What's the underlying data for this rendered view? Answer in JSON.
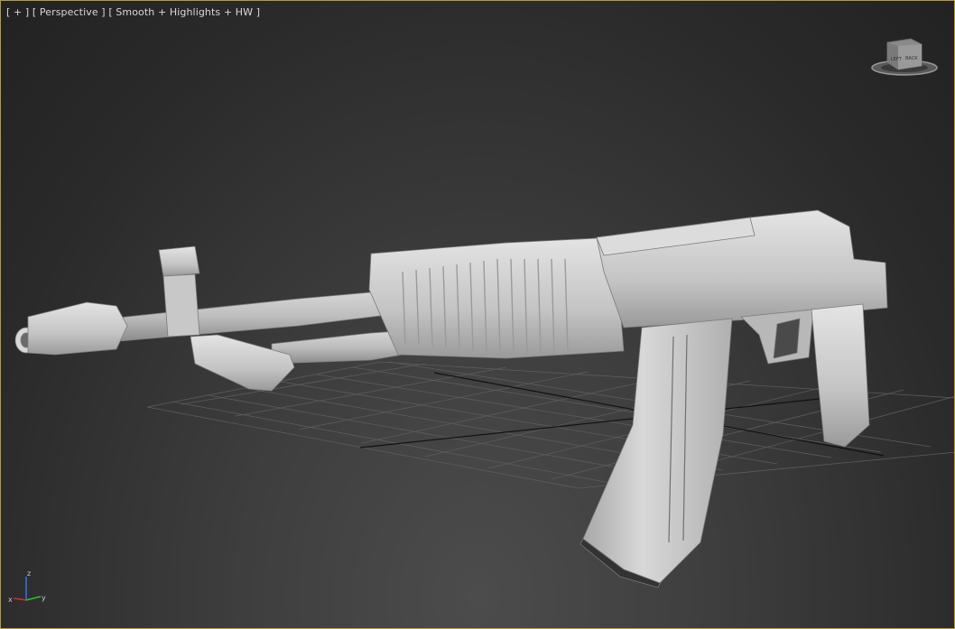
{
  "viewport": {
    "label_plus": "[ + ]",
    "label_view": "[ Perspective ]",
    "label_shading": "[ Smooth + Highlights + HW ]",
    "border_color": "#b89a3a",
    "background_color": "#3a3a3a"
  },
  "viewcube": {
    "icon": "viewcube-icon",
    "face_left": "LEFT",
    "face_front": "BACK"
  },
  "axis_triad": {
    "icon": "axis-triad-icon",
    "z_label": "z",
    "x_label": "x",
    "y_label": "y",
    "x_color": "#d03030",
    "y_color": "#30c030",
    "z_color": "#3070e0"
  },
  "scene": {
    "grid_color": "#5a5a5a",
    "model_color": "#c8c8c8",
    "model": "rifle-model"
  }
}
